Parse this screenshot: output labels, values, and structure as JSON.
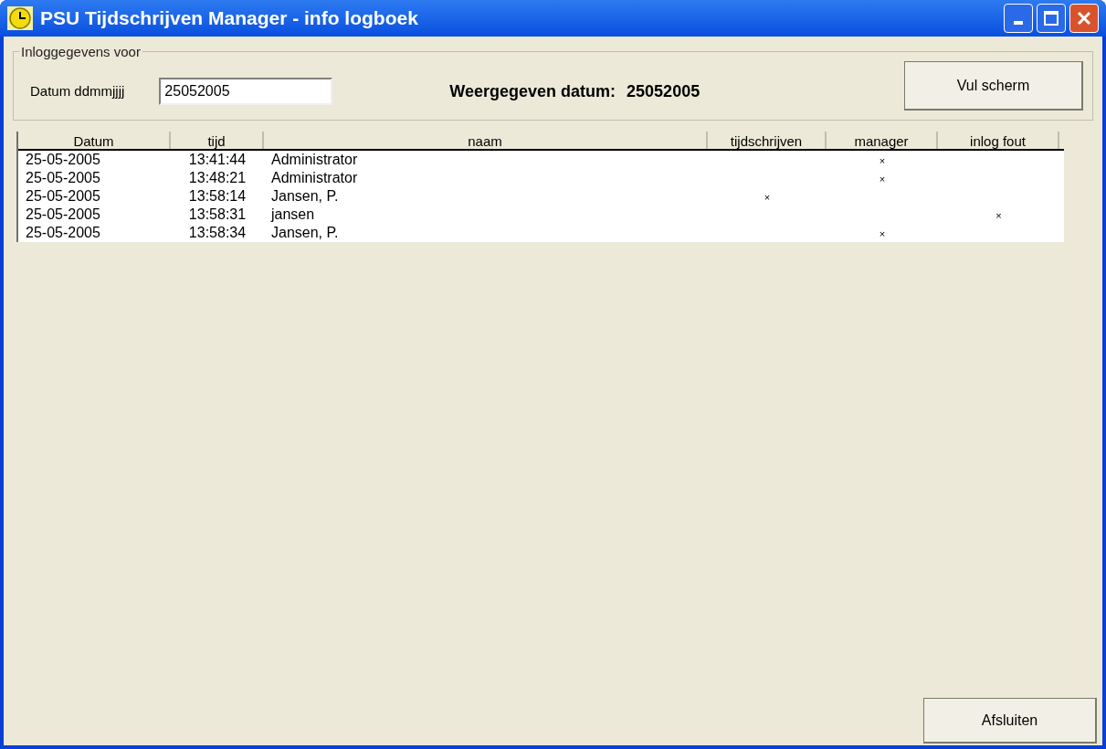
{
  "window": {
    "title": "PSU Tijdschrijven Manager - info logboek"
  },
  "group": {
    "label": "Inloggegevens voor",
    "date_label": "Datum ddmmjjjj",
    "date_value": "25052005",
    "shown_label": "Weergegeven datum:",
    "shown_value": "25052005",
    "fill_button": "Vul scherm"
  },
  "table": {
    "columns": [
      "Datum",
      "tijd",
      "naam",
      "tijdschrijven",
      "manager",
      "inlog fout"
    ],
    "rows": [
      {
        "datum": "25-05-2005",
        "tijd": "13:41:44",
        "naam": "Administrator",
        "manager": "×"
      },
      {
        "datum": "25-05-2005",
        "tijd": "13:48:21",
        "naam": "Administrator",
        "manager": "×"
      },
      {
        "datum": "25-05-2005",
        "tijd": "13:58:14",
        "naam": "Jansen, P.",
        "tijdschrijven": "×"
      },
      {
        "datum": "25-05-2005",
        "tijd": "13:58:31",
        "naam": "jansen",
        "inlog_fout": "×"
      },
      {
        "datum": "25-05-2005",
        "tijd": "13:58:34",
        "naam": "Jansen, P.",
        "manager": "×"
      }
    ]
  },
  "close_button": "Afsluiten"
}
